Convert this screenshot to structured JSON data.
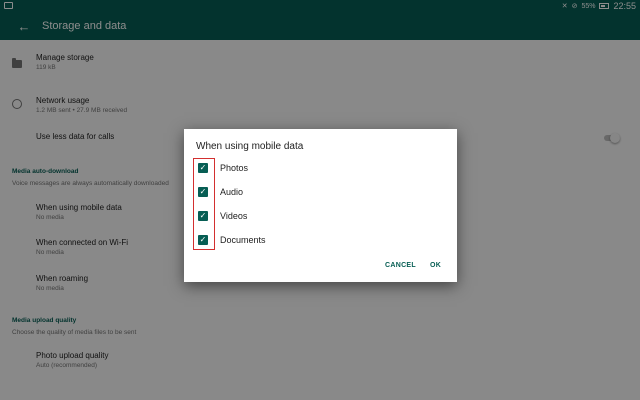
{
  "status_bar": {
    "battery": "55%",
    "time": "22:55"
  },
  "app_bar": {
    "title": "Storage and data"
  },
  "settings": {
    "manage_storage": {
      "title": "Manage storage",
      "subtitle": "119 kB"
    },
    "network_usage": {
      "title": "Network usage",
      "subtitle": "1.2 MB sent • 27.9 MB received"
    },
    "less_data": {
      "title": "Use less data for calls",
      "enabled": false
    },
    "media_auto_download": {
      "header": "Media auto-download",
      "note": "Voice messages are always automatically downloaded",
      "items": [
        {
          "title": "When using mobile data",
          "subtitle": "No media"
        },
        {
          "title": "When connected on Wi-Fi",
          "subtitle": "No media"
        },
        {
          "title": "When roaming",
          "subtitle": "No media"
        }
      ]
    },
    "media_upload": {
      "header": "Media upload quality",
      "note": "Choose the quality of media files to be sent",
      "photo_quality": {
        "title": "Photo upload quality",
        "subtitle": "Auto (recommended)"
      }
    }
  },
  "dialog": {
    "title": "When using mobile data",
    "options": [
      {
        "label": "Photos",
        "checked": true
      },
      {
        "label": "Audio",
        "checked": true
      },
      {
        "label": "Videos",
        "checked": true
      },
      {
        "label": "Documents",
        "checked": true
      }
    ],
    "cancel_label": "CANCEL",
    "ok_label": "OK"
  },
  "colors": {
    "primary": "#075e54",
    "highlight": "#d32f2f"
  }
}
